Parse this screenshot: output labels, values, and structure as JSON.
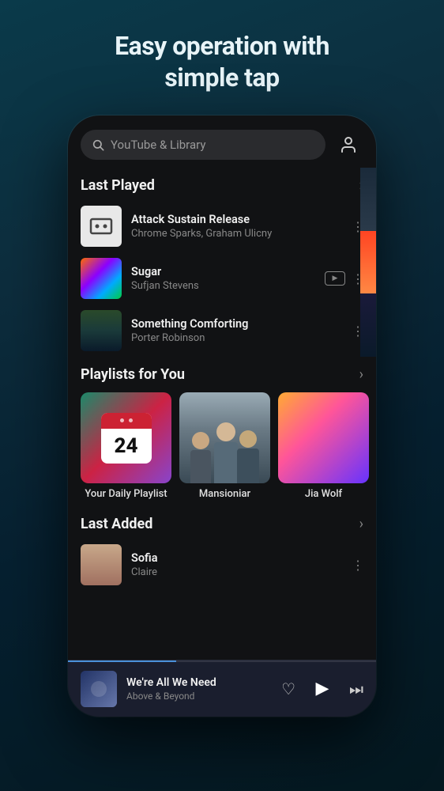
{
  "page": {
    "title_line1": "Easy operation with",
    "title_line2": "simple tap"
  },
  "search": {
    "placeholder": "YouTube & Library"
  },
  "sections": {
    "last_played_label": "Last Played",
    "playlists_label": "Playlists for You",
    "last_added_label": "Last Added"
  },
  "tracks": [
    {
      "title": "Attack Sustain Release",
      "artist": "Chrome Sparks, Graham Ulicny",
      "has_youtube": false
    },
    {
      "title": "Sugar",
      "artist": "Sufjan Stevens",
      "has_youtube": true
    },
    {
      "title": "Something Comforting",
      "artist": "Porter Robinson",
      "has_youtube": false
    }
  ],
  "playlists": [
    {
      "name": "Your Daily Playlist",
      "number": "24"
    },
    {
      "name": "Mansioniar"
    },
    {
      "name": "Jia Wolf"
    }
  ],
  "last_added": [
    {
      "title": "Sofia",
      "artist": "Claire"
    }
  ],
  "player": {
    "title": "We're All We Need",
    "artist": "Above & Beyond",
    "progress": 35
  },
  "icons": {
    "search": "🔍",
    "profile": "👤",
    "chevron": "›",
    "more": "⋮",
    "heart": "♡",
    "play": "▶",
    "skip": "⏭"
  }
}
